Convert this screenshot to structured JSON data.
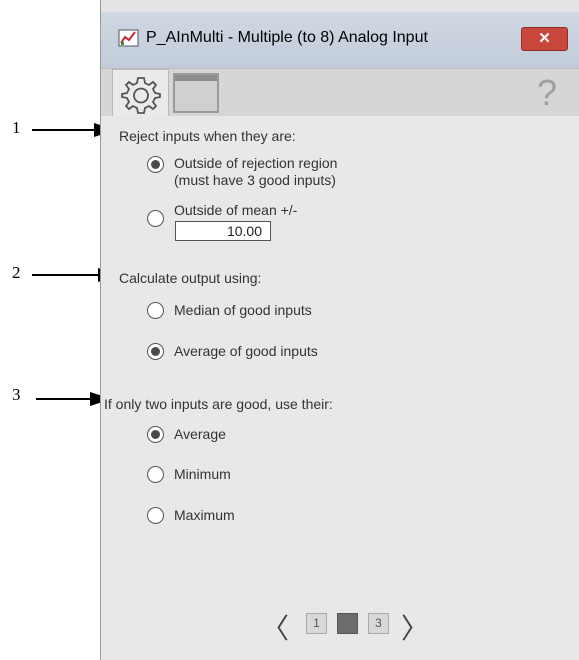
{
  "callouts": [
    "1",
    "2",
    "3"
  ],
  "window": {
    "title": "P_AInMulti - Multiple (to 8) Analog Input",
    "close_label": "✕",
    "help_label": "?"
  },
  "toolbar": {
    "tabs": [
      {
        "name": "settings",
        "icon": "gear-icon",
        "selected": true
      },
      {
        "name": "faceplate",
        "icon": "window-icon",
        "selected": false
      }
    ]
  },
  "reject": {
    "heading": "Reject inputs when they are:",
    "option1_line1": "Outside of rejection region",
    "option1_line2": "(must have 3 good inputs)",
    "option1_selected": true,
    "option2_label": "Outside of mean +/-",
    "option2_selected": false,
    "mean_value": "10.00"
  },
  "calculate": {
    "heading": "Calculate output using:",
    "options": [
      {
        "label": "Median of good inputs",
        "selected": false
      },
      {
        "label": "Average of good inputs",
        "selected": true
      }
    ]
  },
  "two_inputs": {
    "heading": "If only two inputs are good, use their:",
    "options": [
      {
        "label": "Average",
        "selected": true
      },
      {
        "label": "Minimum",
        "selected": false
      },
      {
        "label": "Maximum",
        "selected": false
      }
    ]
  },
  "pager": {
    "prev": "〈",
    "next": "〉",
    "pages": [
      "1",
      "2",
      "3"
    ],
    "current": "2"
  }
}
